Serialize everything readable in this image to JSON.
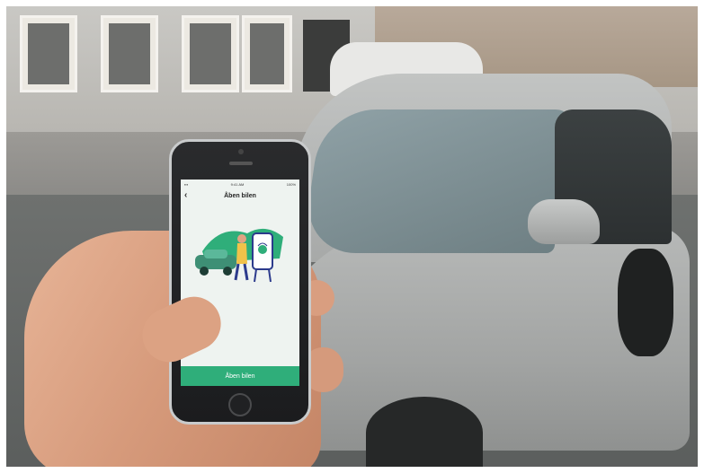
{
  "phone": {
    "status_time": "9:41 AM",
    "status_battery": "100%",
    "screen_title": "Åben bilen",
    "back_icon": "chevron-left-icon",
    "cta_label": "Åben bilen",
    "accent_color": "#2fae7a"
  },
  "scene": {
    "car_color": "silver"
  }
}
